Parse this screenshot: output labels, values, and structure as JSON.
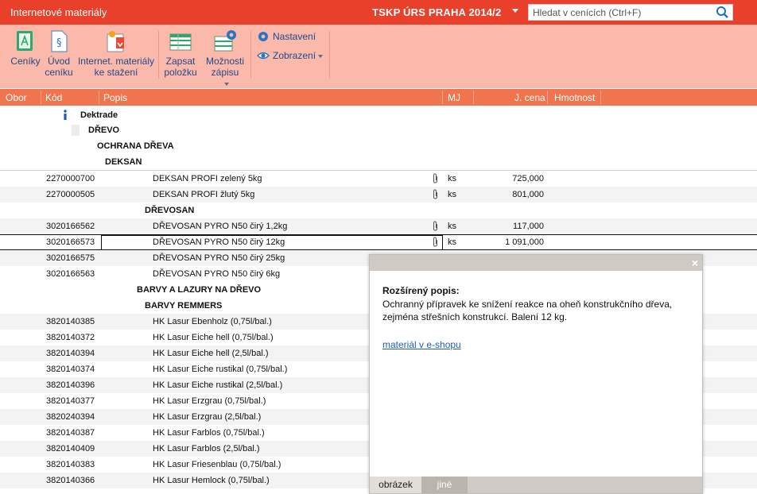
{
  "title_bar": {
    "app_title": "Internetové materiály",
    "database": "TSKP ÚRS PRAHA 2014/2",
    "search_placeholder": "Hledat v cenících (Ctrl+F)"
  },
  "ribbon": {
    "ceniky": "Ceníky",
    "uvod_line1": "Úvod",
    "uvod_line2": "ceníku",
    "internet_line1": "Internet. materiály",
    "internet_line2": "ke stažení",
    "zapsat_line1": "Zapsat",
    "zapsat_line2": "položku",
    "moznosti_line1": "Možnosti",
    "moznosti_line2": "zápisu",
    "nastaveni": "Nastavení",
    "zobrazeni": "Zobrazení"
  },
  "columns": {
    "obor": "Obor",
    "kod": "Kód",
    "popis": "Popis",
    "mj": "MJ",
    "cena": "J. cena",
    "hmotnost": "Hmotnost"
  },
  "tree": {
    "vendor": "Dektrade",
    "g_drevo": "DŘEVO",
    "g_ochrana": "OCHRANA DŘEVA",
    "g_deksan": "DEKSAN",
    "g_drevosan": "DŘEVOSAN",
    "g_barvy": "BARVY A LAZURY NA DŘEVO",
    "g_remmers": "BARVY REMMERS"
  },
  "rows": [
    {
      "kod": "2270000700",
      "popis": "DEKSAN PROFI zelený 5kg",
      "mj": "ks",
      "cena": "725,000"
    },
    {
      "kod": "2270000505",
      "popis": "DEKSAN PROFI žlutý 5kg",
      "mj": "ks",
      "cena": "801,000"
    },
    {
      "kod": "3020166562",
      "popis": "DŘEVOSAN PYRO N50 čirý 1,2kg",
      "mj": "ks",
      "cena": "117,000"
    },
    {
      "kod": "3020166573",
      "popis": "DŘEVOSAN PYRO N50 čirý 12kg",
      "mj": "ks",
      "cena": "1 091,000"
    },
    {
      "kod": "3020166575",
      "popis": "DŘEVOSAN PYRO N50 čirý 25kg",
      "mj": "",
      "cena": ""
    },
    {
      "kod": "3020166563",
      "popis": "DŘEVOSAN PYRO N50 čirý 6kg",
      "mj": "",
      "cena": ""
    },
    {
      "kod": "3820140385",
      "popis": "HK Lasur Ebenholz (0,75l/bal.)",
      "mj": "",
      "cena": ""
    },
    {
      "kod": "3820140372",
      "popis": "HK Lasur Eiche hell (0,75l/bal.)",
      "mj": "",
      "cena": ""
    },
    {
      "kod": "3820140394",
      "popis": "HK Lasur Eiche hell (2,5l/bal.)",
      "mj": "",
      "cena": ""
    },
    {
      "kod": "3820140374",
      "popis": "HK Lasur Eiche rustikal (0,75l/bal.)",
      "mj": "",
      "cena": ""
    },
    {
      "kod": "3820140396",
      "popis": "HK Lasur Eiche rustikal (2,5l/bal.)",
      "mj": "",
      "cena": ""
    },
    {
      "kod": "3820140377",
      "popis": "HK Lasur Erzgrau (0,75l/bal.)",
      "mj": "",
      "cena": ""
    },
    {
      "kod": "3820240394",
      "popis": "HK Lasur Erzgrau (2,5l/bal.)",
      "mj": "",
      "cena": ""
    },
    {
      "kod": "3820140387",
      "popis": "HK Lasur Farblos (0,75l/bal.)",
      "mj": "",
      "cena": ""
    },
    {
      "kod": "3820140409",
      "popis": "HK Lasur Farblos (2,5l/bal.)",
      "mj": "",
      "cena": ""
    },
    {
      "kod": "3820140383",
      "popis": "HK Lasur Friesenblau (0,75l/bal.)",
      "mj": "",
      "cena": ""
    },
    {
      "kod": "3820140366",
      "popis": "HK Lasur Hemlock (0,75l/bal.)",
      "mj": "",
      "cena": ""
    }
  ],
  "popup": {
    "close": "×",
    "title": "Rozšírený popis:",
    "text": "Ochranný přípravek ke snížení reakce na oheň konstrukčního dřeva, zejména střešních konstrukcí. Balení 12 kg.",
    "link": "materiál v e-shopu",
    "tab_obrazek": "obrázek",
    "tab_jine": "jiné"
  },
  "colors": {
    "title_bar": "#e8402a",
    "ribbon": "#fbb9ac",
    "header": "#f0744d",
    "link": "#1e5fb3"
  }
}
